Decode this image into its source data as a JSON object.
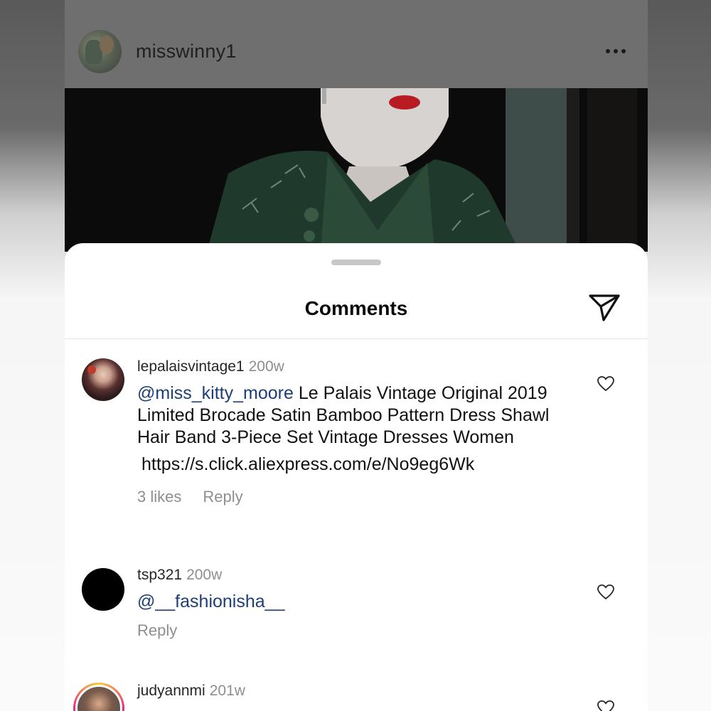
{
  "post": {
    "username": "misswinny1",
    "more_icon": "more-dots-icon"
  },
  "sheet": {
    "title": "Comments",
    "share_icon": "paper-plane-icon"
  },
  "comments": [
    {
      "username": "lepalaisvintage1",
      "time": "200w",
      "mention": "@miss_kitty_moore",
      "text": " Le Palais Vintage Original 2019 Limited Brocade Satin Bamboo Pattern Dress Shawl Hair Band 3-Piece Set Vintage Dresses Women",
      "link": "https://s.click.aliexpress.com/e/No9eg6Wk",
      "likes": "3 likes",
      "reply": "Reply"
    },
    {
      "username": "tsp321",
      "time": "200w",
      "mention": "@__fashionisha__",
      "reply": "Reply"
    },
    {
      "username": "judyannmi",
      "time": "201w"
    }
  ],
  "colors": {
    "mention": "#1c3f78",
    "secondary_text": "#8e8e8e",
    "primary_text": "#111111"
  }
}
